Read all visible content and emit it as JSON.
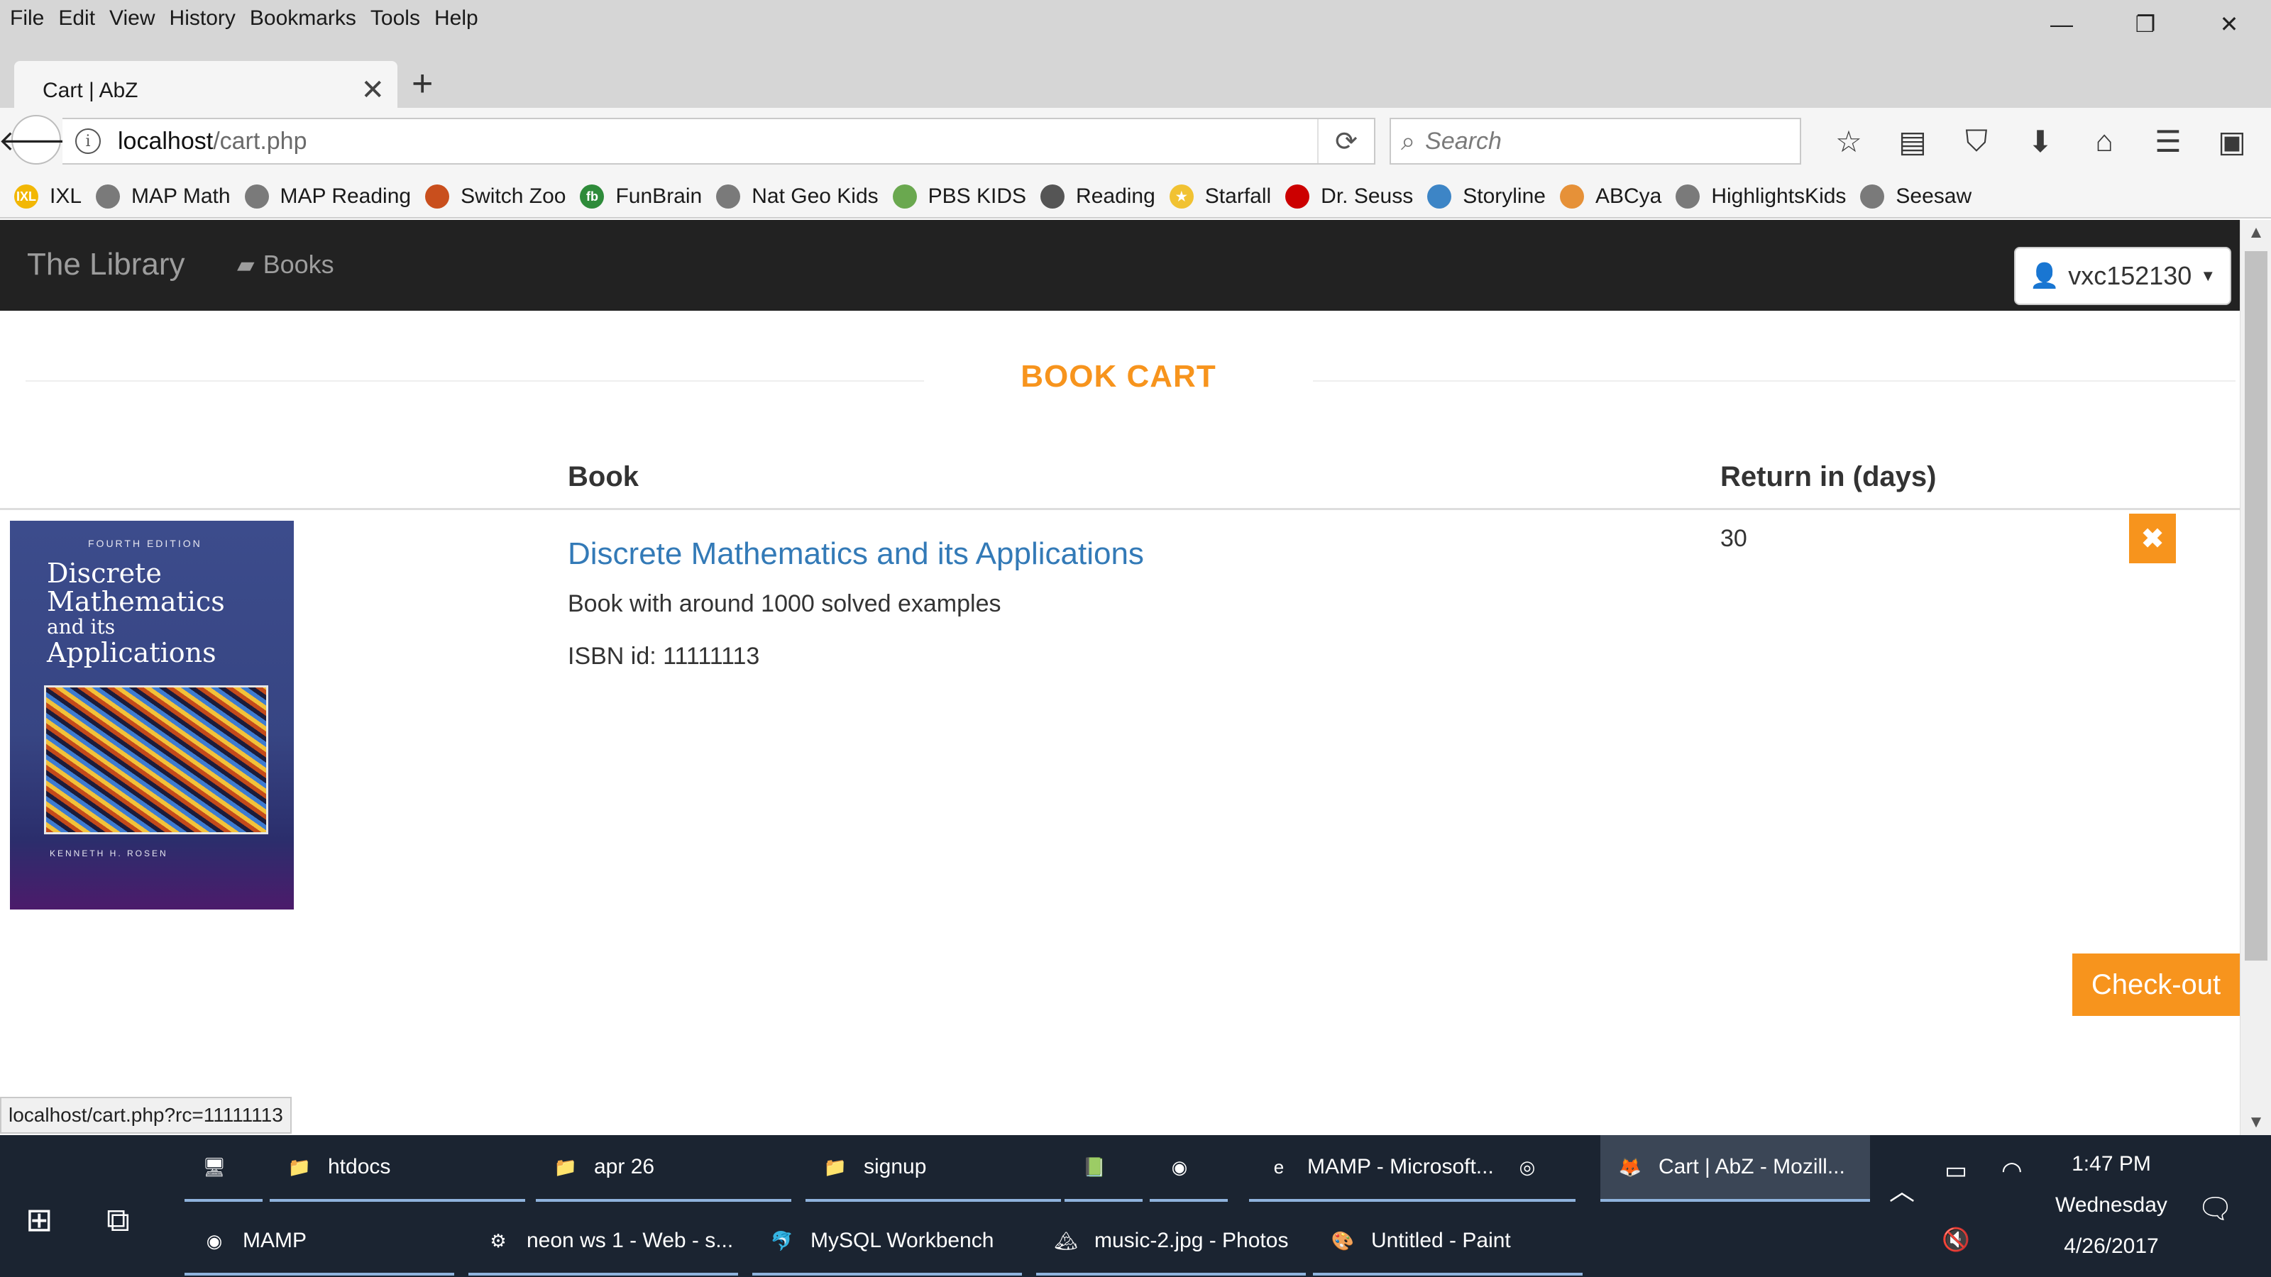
{
  "menubar": {
    "items": [
      "File",
      "Edit",
      "View",
      "History",
      "Bookmarks",
      "Tools",
      "Help"
    ]
  },
  "window": {
    "minimize": "—",
    "restore": "❐",
    "close": "✕"
  },
  "tab": {
    "title": "Cart | AbZ",
    "close": "✕",
    "new": "+"
  },
  "nav": {
    "back": "🡐",
    "url_host": "localhost",
    "url_path": "/cart.php",
    "info": "i",
    "reload": "⟳",
    "search_placeholder": "Search"
  },
  "bookmarks": [
    {
      "label": "IXL",
      "color": "#f2b705",
      "glyph": "IXL"
    },
    {
      "label": "MAP Math",
      "color": "#7a7a7a",
      "glyph": ""
    },
    {
      "label": "MAP Reading",
      "color": "#7a7a7a",
      "glyph": ""
    },
    {
      "label": "Switch Zoo",
      "color": "#c94f1d",
      "glyph": ""
    },
    {
      "label": "FunBrain",
      "color": "#2e8b3a",
      "glyph": "fb"
    },
    {
      "label": "Nat Geo Kids",
      "color": "#7a7a7a",
      "glyph": ""
    },
    {
      "label": "PBS KIDS",
      "color": "#6aa84f",
      "glyph": ""
    },
    {
      "label": "Reading",
      "color": "#555555",
      "glyph": ""
    },
    {
      "label": "Starfall",
      "color": "#f1c232",
      "glyph": "★"
    },
    {
      "label": "Dr. Seuss",
      "color": "#cc0000",
      "glyph": ""
    },
    {
      "label": "Storyline",
      "color": "#3d85c6",
      "glyph": ""
    },
    {
      "label": "ABCya",
      "color": "#e69138",
      "glyph": ""
    },
    {
      "label": "HighlightsKids",
      "color": "#7a7a7a",
      "glyph": ""
    },
    {
      "label": "Seesaw",
      "color": "#7a7a7a",
      "glyph": ""
    }
  ],
  "site": {
    "brand": "The Library",
    "books_link": "Books",
    "user": "vxc152130"
  },
  "cart": {
    "title": "BOOK CART",
    "col_book": "Book",
    "col_return": "Return in (days)",
    "items": [
      {
        "title": "Discrete Mathematics and its Applications",
        "description": "Book with around 1000 solved examples",
        "isbn": "ISBN id: 11111113",
        "return_days": "30",
        "cover": {
          "edition": "FOURTH EDITION",
          "line1": "Discrete",
          "line2": "Mathematics",
          "line3": "and its",
          "line4": "Applications",
          "author": "KENNETH H. ROSEN"
        }
      }
    ],
    "remove_label": "✖",
    "checkout": "Check-out"
  },
  "status_url": "localhost/cart.php?rc=11111113",
  "taskbar": {
    "row1": [
      {
        "label": "",
        "icon": "🖥"
      },
      {
        "label": "htdocs",
        "icon": "📁"
      },
      {
        "label": "apr 26",
        "icon": "📁"
      },
      {
        "label": "signup",
        "icon": "📁"
      },
      {
        "label": "",
        "icon": "📗"
      },
      {
        "label": "",
        "icon": "◉"
      },
      {
        "label": "MAMP - Microsoft...",
        "icon": "e"
      },
      {
        "label": "",
        "icon": "◎"
      },
      {
        "label": "Cart | AbZ - Mozill...",
        "icon": "🦊"
      }
    ],
    "row2": [
      {
        "label": "MAMP",
        "icon": "◉"
      },
      {
        "label": "neon ws 1 - Web - s...",
        "icon": "⚙"
      },
      {
        "label": "MySQL Workbench",
        "icon": "🐬"
      },
      {
        "label": "music-2.jpg - Photos",
        "icon": "🏔"
      },
      {
        "label": "Untitled - Paint",
        "icon": "🎨"
      }
    ],
    "clock": {
      "time": "1:47 PM",
      "day": "Wednesday",
      "date": "4/26/2017"
    }
  }
}
